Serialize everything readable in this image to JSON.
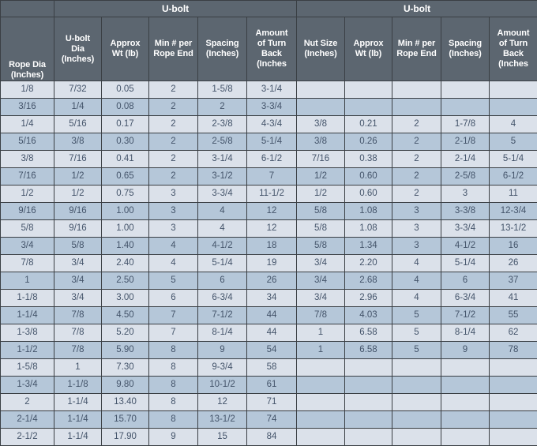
{
  "table": {
    "group_headers": [
      {
        "label": "",
        "span": 1
      },
      {
        "label": "U-bolt",
        "span": 5
      },
      {
        "label": "U-bolt",
        "span": 5
      }
    ],
    "columns": [
      {
        "key": "rope_dia",
        "lines": [
          "Rope Dia",
          "(Inches)"
        ]
      },
      {
        "key": "ub_dia",
        "lines": [
          "U-bolt",
          "Dia",
          "(Inches)"
        ]
      },
      {
        "key": "ub_wt",
        "lines": [
          "Approx",
          "Wt (lb)"
        ]
      },
      {
        "key": "ub_min",
        "lines": [
          "Min # per",
          "Rope End"
        ]
      },
      {
        "key": "ub_spacing",
        "lines": [
          "Spacing",
          "(Inches)"
        ]
      },
      {
        "key": "ub_turn",
        "lines": [
          "Amount",
          "of Turn",
          "Back",
          "(Inches"
        ]
      },
      {
        "key": "nut_size",
        "lines": [
          "Nut Size",
          "(Inches)"
        ]
      },
      {
        "key": "nut_wt",
        "lines": [
          "Approx",
          "Wt (lb)"
        ]
      },
      {
        "key": "nut_min",
        "lines": [
          "Min # per",
          "Rope End"
        ]
      },
      {
        "key": "nut_spacing",
        "lines": [
          "Spacing",
          "(Inches)"
        ]
      },
      {
        "key": "nut_turn",
        "lines": [
          "Amount",
          "of Turn",
          "Back",
          "(Inches"
        ]
      }
    ],
    "rows": [
      [
        "1/8",
        "7/32",
        "0.05",
        "2",
        "1-5/8",
        "3-1/4",
        "",
        "",
        "",
        "",
        ""
      ],
      [
        "3/16",
        "1/4",
        "0.08",
        "2",
        "2",
        "3-3/4",
        "",
        "",
        "",
        "",
        ""
      ],
      [
        "1/4",
        "5/16",
        "0.17",
        "2",
        "2-3/8",
        "4-3/4",
        "3/8",
        "0.21",
        "2",
        "1-7/8",
        "4"
      ],
      [
        "5/16",
        "3/8",
        "0.30",
        "2",
        "2-5/8",
        "5-1/4",
        "3/8",
        "0.26",
        "2",
        "2-1/8",
        "5"
      ],
      [
        "3/8",
        "7/16",
        "0.41",
        "2",
        "3-1/4",
        "6-1/2",
        "7/16",
        "0.38",
        "2",
        "2-1/4",
        "5-1/4"
      ],
      [
        "7/16",
        "1/2",
        "0.65",
        "2",
        "3-1/2",
        "7",
        "1/2",
        "0.60",
        "2",
        "2-5/8",
        "6-1/2"
      ],
      [
        "1/2",
        "1/2",
        "0.75",
        "3",
        "3-3/4",
        "11-1/2",
        "1/2",
        "0.60",
        "2",
        "3",
        "11"
      ],
      [
        "9/16",
        "9/16",
        "1.00",
        "3",
        "4",
        "12",
        "5/8",
        "1.08",
        "3",
        "3-3/8",
        "12-3/4"
      ],
      [
        "5/8",
        "9/16",
        "1.00",
        "3",
        "4",
        "12",
        "5/8",
        "1.08",
        "3",
        "3-3/4",
        "13-1/2"
      ],
      [
        "3/4",
        "5/8",
        "1.40",
        "4",
        "4-1/2",
        "18",
        "5/8",
        "1.34",
        "3",
        "4-1/2",
        "16"
      ],
      [
        "7/8",
        "3/4",
        "2.40",
        "4",
        "5-1/4",
        "19",
        "3/4",
        "2.20",
        "4",
        "5-1/4",
        "26"
      ],
      [
        "1",
        "3/4",
        "2.50",
        "5",
        "6",
        "26",
        "3/4",
        "2.68",
        "4",
        "6",
        "37"
      ],
      [
        "1-1/8",
        "3/4",
        "3.00",
        "6",
        "6-3/4",
        "34",
        "3/4",
        "2.96",
        "4",
        "6-3/4",
        "41"
      ],
      [
        "1-1/4",
        "7/8",
        "4.50",
        "7",
        "7-1/2",
        "44",
        "7/8",
        "4.03",
        "5",
        "7-1/2",
        "55"
      ],
      [
        "1-3/8",
        "7/8",
        "5.20",
        "7",
        "8-1/4",
        "44",
        "1",
        "6.58",
        "5",
        "8-1/4",
        "62"
      ],
      [
        "1-1/2",
        "7/8",
        "5.90",
        "8",
        "9",
        "54",
        "1",
        "6.58",
        "5",
        "9",
        "78"
      ],
      [
        "1-5/8",
        "1",
        "7.30",
        "8",
        "9-3/4",
        "58",
        "",
        "",
        "",
        "",
        ""
      ],
      [
        "1-3/4",
        "1-1/8",
        "9.80",
        "8",
        "10-1/2",
        "61",
        "",
        "",
        "",
        "",
        ""
      ],
      [
        "2",
        "1-1/4",
        "13.40",
        "8",
        "12",
        "71",
        "",
        "",
        "",
        "",
        ""
      ],
      [
        "2-1/4",
        "1-1/4",
        "15.70",
        "8",
        "13-1/2",
        "74",
        "",
        "",
        "",
        "",
        ""
      ],
      [
        "2-1/2",
        "1-1/4",
        "17.90",
        "9",
        "15",
        "84",
        "",
        "",
        "",
        "",
        ""
      ]
    ]
  },
  "colors": {
    "header_bg": "#5c6670",
    "header_text": "#ffffff",
    "row_light": "#dbe1ea",
    "row_dark": "#b5c7d9",
    "cell_text": "#44546a",
    "border": "#3a3f44"
  }
}
